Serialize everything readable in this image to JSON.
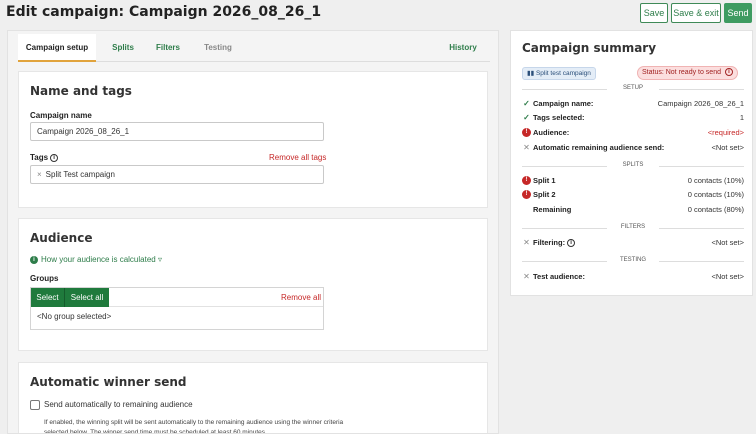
{
  "header": {
    "title": "Edit campaign: Campaign 2026_08_26_1",
    "save_label": "Save",
    "save_exit_label": "Save & exit",
    "send_label": "Send"
  },
  "tabs": {
    "setup": "Campaign setup",
    "splits": "Splits",
    "filters": "Filters",
    "testing": "Testing",
    "history": "History"
  },
  "name_tags": {
    "title": "Name and tags",
    "campaign_name_label": "Campaign name",
    "campaign_name_value": "Campaign 2026_08_26_1",
    "tags_label": "Tags",
    "remove_all_tags": "Remove all tags",
    "tag_chip": "Split Test campaign",
    "chip_remove": "×"
  },
  "audience": {
    "title": "Audience",
    "how_link": "How your audience is calculated",
    "how_caret": "▿",
    "groups_label": "Groups",
    "select_label": "Select",
    "select_all_label": "Select all",
    "remove_all": "Remove all",
    "empty_text": "<No group selected>"
  },
  "winner": {
    "title": "Automatic winner send",
    "checkbox_label": "Send automatically to remaining audience",
    "checked": false,
    "help_text": "If enabled, the winning split will be sent automatically to the remaining audience using the winner criteria selected below. The winner send time must be scheduled at least 60 minutes"
  },
  "summary": {
    "title": "Campaign summary",
    "badge": "Split test campaign",
    "status": "Status: Not ready to send",
    "sections": {
      "setup": "SETUP",
      "splits": "SPLITS",
      "filters": "FILTERS",
      "testing": "TESTING"
    },
    "rows": {
      "campaign_name": {
        "label": "Campaign name:",
        "value": "Campaign 2026_08_26_1"
      },
      "tags_selected": {
        "label": "Tags selected:",
        "value": "1"
      },
      "audience": {
        "label": "Audience:",
        "value": "<required>"
      },
      "auto_remaining": {
        "label": "Automatic remaining audience send:",
        "value": "<Not set>"
      },
      "split1": {
        "label": "Split 1",
        "value": "0 contacts (10%)"
      },
      "split2": {
        "label": "Split 2",
        "value": "0 contacts (10%)"
      },
      "remaining": {
        "label": "Remaining",
        "value": "0 contacts (80%)"
      },
      "filtering": {
        "label": "Filtering:",
        "value": "<Not set>"
      },
      "test_audience": {
        "label": "Test audience:",
        "value": "<Not set>"
      }
    }
  },
  "colors": {
    "accent_green": "#2e7d4a",
    "dark_green": "#1f7a3c",
    "error_red": "#c62828",
    "tab_underline": "#e1a33c"
  },
  "icons": {
    "check": "✓",
    "error": "!",
    "unset": "✕",
    "info": "i"
  }
}
